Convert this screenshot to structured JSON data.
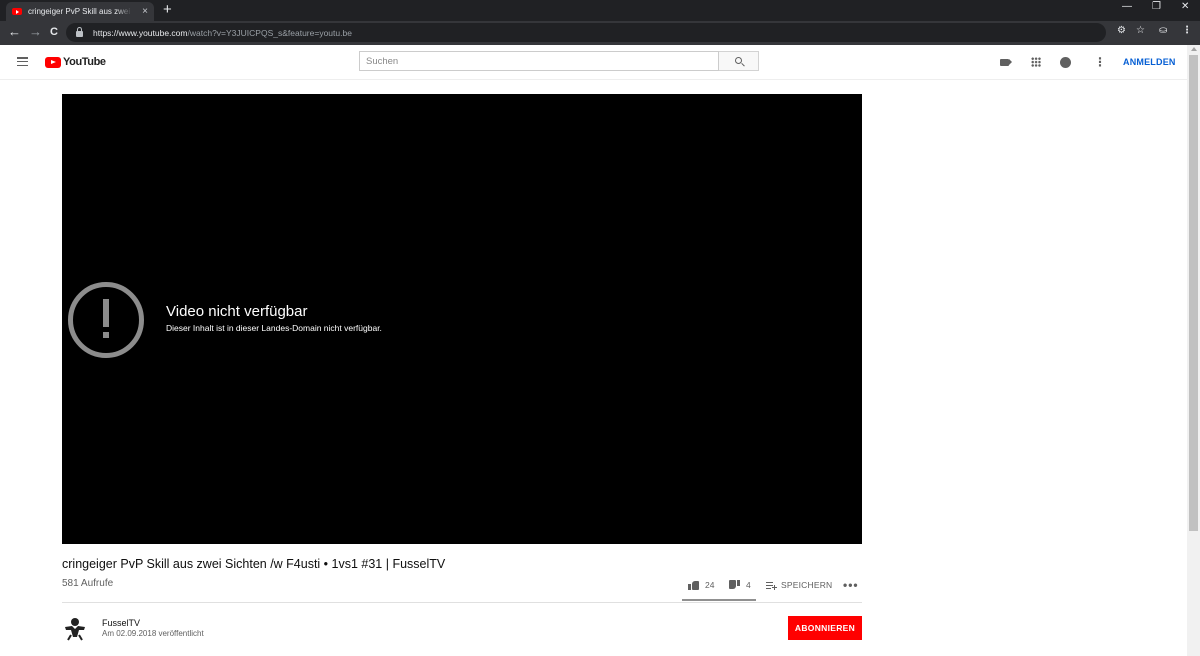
{
  "browser": {
    "tab_title": "cringeiger PvP Skill aus zwei Sichten /w F4usti • 1vs1 #31 | FusselTV",
    "tab_close": "×",
    "new_tab": "+",
    "url_main": "https://www.youtube.com",
    "url_rest": "/watch?v=Y3JUICPQS_s&feature=youtu.be",
    "nav_back": "←",
    "nav_forward": "→",
    "nav_reload": "C",
    "win_min": "—",
    "win_restore": "❐",
    "win_close": "✕",
    "bookmark": "☆",
    "menu": "⋮",
    "incognito": "⛀"
  },
  "masthead": {
    "logo_text": "YouTube",
    "search_placeholder": "Suchen",
    "more": "⋮",
    "signin_label": "ANMELDEN"
  },
  "player": {
    "error_title": "Video nicht verfügbar",
    "error_message": "Dieser Inhalt ist in dieser Landes-Domain nicht verfügbar."
  },
  "video": {
    "title": "cringeiger PvP Skill aus zwei Sichten /w F4usti • 1vs1 #31 | FusselTV",
    "views": "581 Aufrufe",
    "likes": "24",
    "dislikes": "4",
    "save_label": "SPEICHERN",
    "more": "•••",
    "like_ratio": 0.86
  },
  "channel": {
    "name": "FusselTV",
    "published": "Am 02.09.2018 veröffentlicht",
    "subscribe_label": "ABONNIEREN"
  },
  "colors": {
    "brand_red": "#ff0000",
    "link_blue": "#065fd4",
    "chrome_dark": "#202124"
  }
}
